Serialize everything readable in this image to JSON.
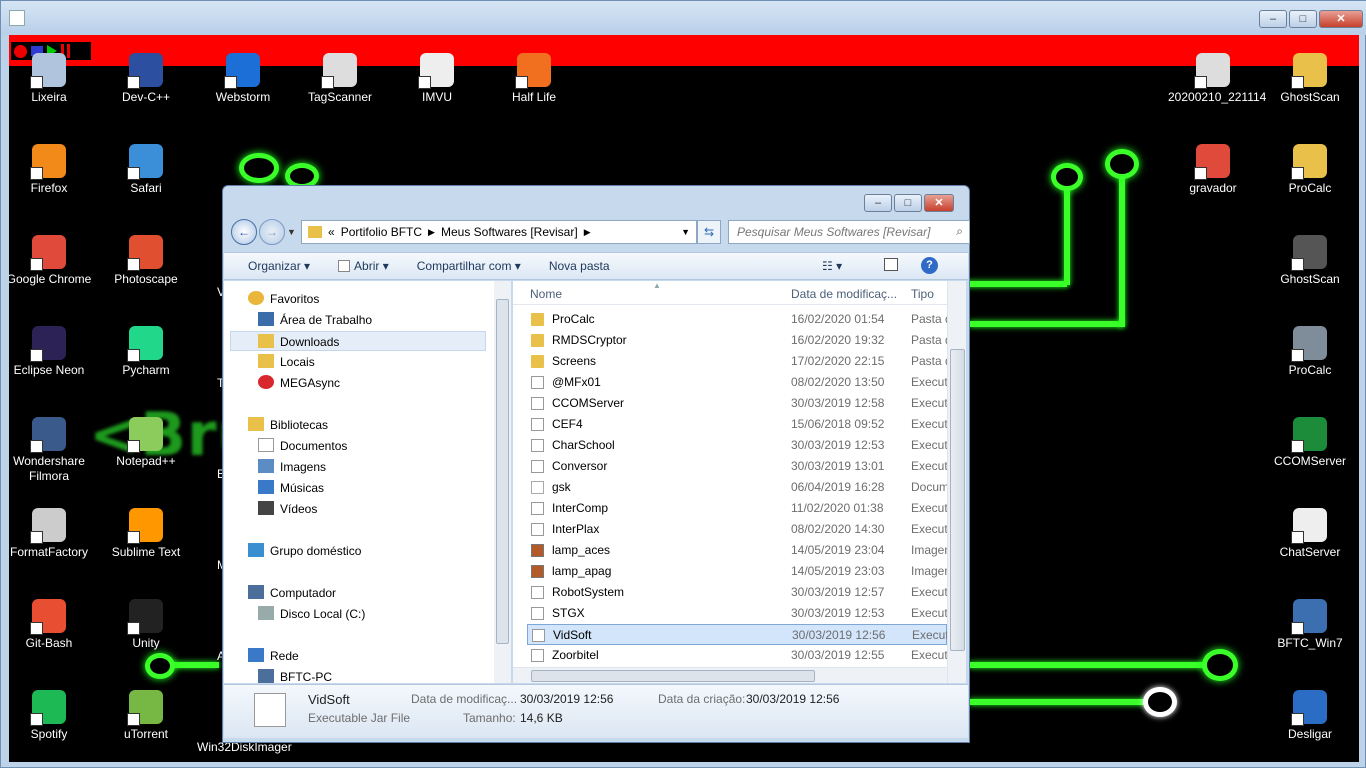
{
  "recorder_controls": [
    "record",
    "stop",
    "play",
    "pause"
  ],
  "desktop_icons": [
    {
      "label": "Lixeira",
      "icon": "trash-icon",
      "color": "#b0c4de"
    },
    {
      "label": "Dev-C++",
      "icon": "devcpp-icon",
      "color": "#2d4fa0"
    },
    {
      "label": "Webstorm",
      "icon": "webstorm-icon",
      "color": "#1b6fd6"
    },
    {
      "label": "TagScanner",
      "icon": "tagscanner-icon",
      "color": "#dddddd"
    },
    {
      "label": "IMVU",
      "icon": "imvu-icon",
      "color": "#eeeeee"
    },
    {
      "label": "Half Life",
      "icon": "halflife-icon",
      "color": "#f07020"
    },
    {
      "label": "20200210_221114",
      "icon": "image-icon",
      "color": "#dddddd"
    },
    {
      "label": "GhostScan",
      "icon": "folder-icon",
      "color": "#e8c04a"
    },
    {
      "label": "Firefox",
      "icon": "firefox-icon",
      "color": "#f28a1a"
    },
    {
      "label": "Safari",
      "icon": "safari-icon",
      "color": "#3b8fd9"
    },
    {
      "label": "gravador",
      "icon": "chrome-icon",
      "color": "#e04a3a"
    },
    {
      "label": "ProCalc",
      "icon": "folder-icon",
      "color": "#e8c04a"
    },
    {
      "label": "Google Chrome",
      "icon": "chrome-icon",
      "color": "#e04a3a"
    },
    {
      "label": "Photoscape",
      "icon": "photoscape-icon",
      "color": "#e05030"
    },
    {
      "label": "GhostScan",
      "icon": "ghostscan-icon",
      "color": "#555555"
    },
    {
      "label": "Eclipse Neon",
      "icon": "eclipse-icon",
      "color": "#2c2255"
    },
    {
      "label": "Pycharm",
      "icon": "pycharm-icon",
      "color": "#21d789"
    },
    {
      "label": "ProCalc",
      "icon": "calculator-icon",
      "color": "#7f8c99"
    },
    {
      "label": "Wondershare\nFilmora",
      "icon": "filmora-icon",
      "color": "#3a5a8c"
    },
    {
      "label": "Notepad++",
      "icon": "notepad-icon",
      "color": "#8ccc5c"
    },
    {
      "label": "CCOMServer",
      "icon": "java-icon",
      "color": "#1c8c3a"
    },
    {
      "label": "FormatFactory",
      "icon": "formatfactory-icon",
      "color": "#cccccc"
    },
    {
      "label": "Sublime Text",
      "icon": "sublime-icon",
      "color": "#ff9800"
    },
    {
      "label": "ChatServer",
      "icon": "java-icon",
      "color": "#eeeeee"
    },
    {
      "label": "Git-Bash",
      "icon": "git-icon",
      "color": "#e84e31"
    },
    {
      "label": "Unity",
      "icon": "unity-icon",
      "color": "#222222"
    },
    {
      "label": "BFTC_Win7",
      "icon": "virtualbox-icon",
      "color": "#3c6fb0"
    },
    {
      "label": "Spotify",
      "icon": "spotify-icon",
      "color": "#1db954"
    },
    {
      "label": "uTorrent",
      "icon": "utorrent-icon",
      "color": "#77b845"
    },
    {
      "label": "Desligar",
      "icon": "power-icon",
      "color": "#2b6cc4"
    }
  ],
  "partial_labels": {
    "c3_r3": "V",
    "c3_r4": "Te",
    "c3_r5": "B",
    "c3_r6": "M",
    "c3_r7": "A",
    "bottom": "Win32DiskImager"
  },
  "banner_text": "<Bru                                   rporations>",
  "explorer": {
    "breadcrumb": [
      "«",
      "Portifolio BFTC",
      "Meus Softwares [Revisar]"
    ],
    "search_placeholder": "Pesquisar Meus Softwares [Revisar]",
    "commands": [
      "Organizar",
      "Abrir",
      "Compartilhar com",
      "Nova pasta"
    ],
    "nav": [
      {
        "label": "Favoritos",
        "icon": "star-icon",
        "indent": 0
      },
      {
        "label": "Área de Trabalho",
        "icon": "desktop-icon",
        "indent": 1
      },
      {
        "label": "Downloads",
        "icon": "downloads-icon",
        "indent": 1
      },
      {
        "label": "Locais",
        "icon": "places-icon",
        "indent": 1
      },
      {
        "label": "MEGAsync",
        "icon": "mega-icon",
        "indent": 1
      },
      {
        "label": "Bibliotecas",
        "icon": "library-icon",
        "indent": 0
      },
      {
        "label": "Documentos",
        "icon": "documents-icon",
        "indent": 1
      },
      {
        "label": "Imagens",
        "icon": "pictures-icon",
        "indent": 1
      },
      {
        "label": "Músicas",
        "icon": "music-icon",
        "indent": 1
      },
      {
        "label": "Vídeos",
        "icon": "videos-icon",
        "indent": 1
      },
      {
        "label": "Grupo doméstico",
        "icon": "homegroup-icon",
        "indent": 0
      },
      {
        "label": "Computador",
        "icon": "computer-icon",
        "indent": 0
      },
      {
        "label": "Disco Local (C:)",
        "icon": "drive-icon",
        "indent": 1
      },
      {
        "label": "Rede",
        "icon": "network-icon",
        "indent": 0
      },
      {
        "label": "BFTC-PC",
        "icon": "pc-icon",
        "indent": 1
      }
    ],
    "columns": [
      "Nome",
      "Data de modificaç...",
      "Tipo"
    ],
    "files": [
      {
        "name": "ProCalc",
        "date": "16/02/2020 01:54",
        "type": "Pasta d",
        "kind": "folder"
      },
      {
        "name": "RMDSCryptor",
        "date": "16/02/2020 19:32",
        "type": "Pasta d",
        "kind": "folder"
      },
      {
        "name": "Screens",
        "date": "17/02/2020 22:15",
        "type": "Pasta d",
        "kind": "folder"
      },
      {
        "name": "@MFx01",
        "date": "08/02/2020 13:50",
        "type": "Executa",
        "kind": "jar"
      },
      {
        "name": "CCOMServer",
        "date": "30/03/2019 12:58",
        "type": "Executa",
        "kind": "jar"
      },
      {
        "name": "CEF4",
        "date": "15/06/2018 09:52",
        "type": "Executa",
        "kind": "jar"
      },
      {
        "name": "CharSchool",
        "date": "30/03/2019 12:53",
        "type": "Executa",
        "kind": "jar"
      },
      {
        "name": "Conversor",
        "date": "30/03/2019 13:01",
        "type": "Executa",
        "kind": "jar"
      },
      {
        "name": "gsk",
        "date": "06/04/2019 16:28",
        "type": "Docum",
        "kind": "doc"
      },
      {
        "name": "InterComp",
        "date": "11/02/2020 01:38",
        "type": "Executa",
        "kind": "jar"
      },
      {
        "name": "InterPlax",
        "date": "08/02/2020 14:30",
        "type": "Executa",
        "kind": "jar"
      },
      {
        "name": "lamp_aces",
        "date": "14/05/2019 23:04",
        "type": "Imagen",
        "kind": "imgf"
      },
      {
        "name": "lamp_apag",
        "date": "14/05/2019 23:03",
        "type": "Imagen",
        "kind": "imgf"
      },
      {
        "name": "RobotSystem",
        "date": "30/03/2019 12:57",
        "type": "Executa",
        "kind": "jar"
      },
      {
        "name": "STGX",
        "date": "30/03/2019 12:53",
        "type": "Executa",
        "kind": "jar"
      },
      {
        "name": "VidSoft",
        "date": "30/03/2019 12:56",
        "type": "Executa",
        "kind": "jar",
        "selected": true
      },
      {
        "name": "Zoorbitel",
        "date": "30/03/2019 12:55",
        "type": "Executa",
        "kind": "jar"
      }
    ],
    "details": {
      "name": "VidSoft",
      "type": "Executable Jar File",
      "mod_label": "Data de modificaç...",
      "mod_value": "30/03/2019 12:56",
      "size_label": "Tamanho:",
      "size_value": "14,6 KB",
      "created_label": "Data da criação:",
      "created_value": "30/03/2019 12:56"
    }
  }
}
